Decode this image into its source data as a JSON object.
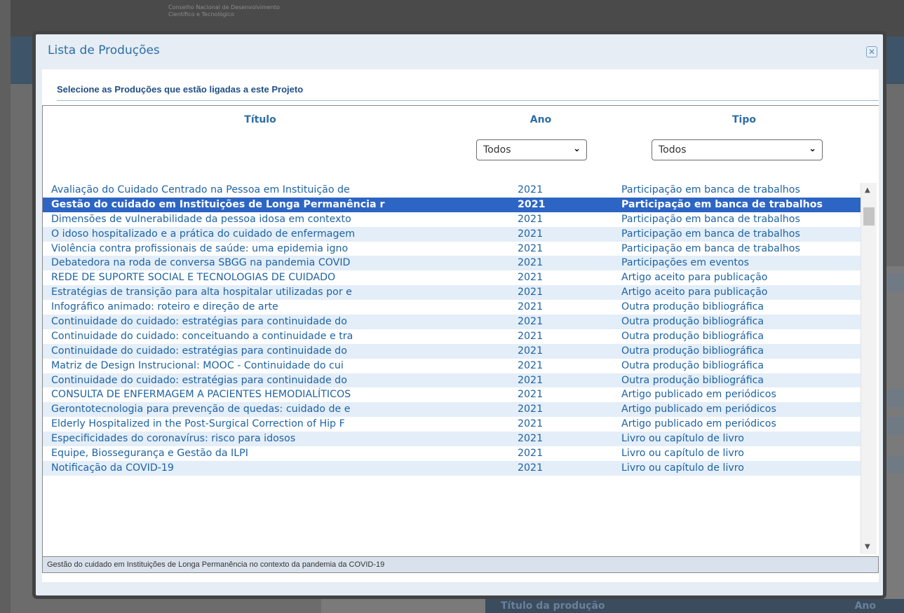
{
  "background": {
    "org_line1": "Conselho Nacional de Desenvolvimento",
    "org_line2": "Científico e Tecnológico",
    "table_header_title": "Título da produção",
    "table_header_ano": "Ano"
  },
  "modal": {
    "title": "Lista de Produções",
    "close_icon": "close-icon",
    "subtitle": "Selecione as Produções que estão ligadas a este Projeto",
    "columns": {
      "titulo": "Título",
      "ano": "Ano",
      "tipo": "Tipo"
    },
    "filters": {
      "ano": "Todos",
      "tipo": "Todos"
    },
    "status_text": "Gestão do cuidado em Instituições de Longa Permanência no contexto da pandemia da COVID-19",
    "rows": [
      {
        "titulo": "Avaliação do Cuidado Centrado na Pessoa em Instituição de",
        "ano": "2021",
        "tipo": "Participação em banca de trabalhos"
      },
      {
        "titulo": "Gestão do cuidado em Instituições de Longa Permanência r",
        "ano": "2021",
        "tipo": "Participação em banca de trabalhos"
      },
      {
        "titulo": "Dimensões de vulnerabilidade da pessoa idosa em contexto",
        "ano": "2021",
        "tipo": "Participação em banca de trabalhos"
      },
      {
        "titulo": "O idoso hospitalizado e a prática do cuidado de enfermagem",
        "ano": "2021",
        "tipo": "Participação em banca de trabalhos"
      },
      {
        "titulo": "Violência contra profissionais de saúde: uma epidemia igno",
        "ano": "2021",
        "tipo": "Participação em banca de trabalhos"
      },
      {
        "titulo": "Debatedora na roda de conversa SBGG na pandemia COVID",
        "ano": "2021",
        "tipo": "Participações em eventos"
      },
      {
        "titulo": "REDE DE SUPORTE SOCIAL E TECNOLOGIAS DE CUIDADO",
        "ano": "2021",
        "tipo": "Artigo aceito para publicação"
      },
      {
        "titulo": "Estratégias de transição para alta hospitalar utilizadas por e",
        "ano": "2021",
        "tipo": "Artigo aceito para publicação"
      },
      {
        "titulo": "Infográfico animado: roteiro e direção de arte",
        "ano": "2021",
        "tipo": "Outra produção bibliográfica"
      },
      {
        "titulo": "Continuidade do cuidado: estratégias para continuidade do",
        "ano": "2021",
        "tipo": "Outra produção bibliográfica"
      },
      {
        "titulo": "Continuidade do cuidado: conceituando a continuidade e tra",
        "ano": "2021",
        "tipo": "Outra produção bibliográfica"
      },
      {
        "titulo": "Continuidade do cuidado: estratégias para continuidade do",
        "ano": "2021",
        "tipo": "Outra produção bibliográfica"
      },
      {
        "titulo": "Matriz de Design Instrucional: MOOC - Continuidade do cui",
        "ano": "2021",
        "tipo": "Outra produção bibliográfica"
      },
      {
        "titulo": "Continuidade do cuidado: estratégias para continuidade do",
        "ano": "2021",
        "tipo": "Outra produção bibliográfica"
      },
      {
        "titulo": "CONSULTA DE ENFERMAGEM A PACIENTES HEMODIALÍTICOS",
        "ano": "2021",
        "tipo": "Artigo publicado em periódicos"
      },
      {
        "titulo": "Gerontotecnologia para prevenção de quedas: cuidado de e",
        "ano": "2021",
        "tipo": "Artigo publicado em periódicos"
      },
      {
        "titulo": "Elderly Hospitalized in the Post-Surgical Correction of Hip F",
        "ano": "2021",
        "tipo": "Artigo publicado em periódicos"
      },
      {
        "titulo": "Especificidades do coronavírus: risco para idosos",
        "ano": "2021",
        "tipo": "Livro ou capítulo de livro"
      },
      {
        "titulo": "Equipe, Biossegurança e Gestão da ILPI",
        "ano": "2021",
        "tipo": "Livro ou capítulo de livro"
      },
      {
        "titulo": "Notificação da COVID-19",
        "ano": "2021",
        "tipo": "Livro ou capítulo de livro"
      }
    ],
    "selected_index": 1
  }
}
